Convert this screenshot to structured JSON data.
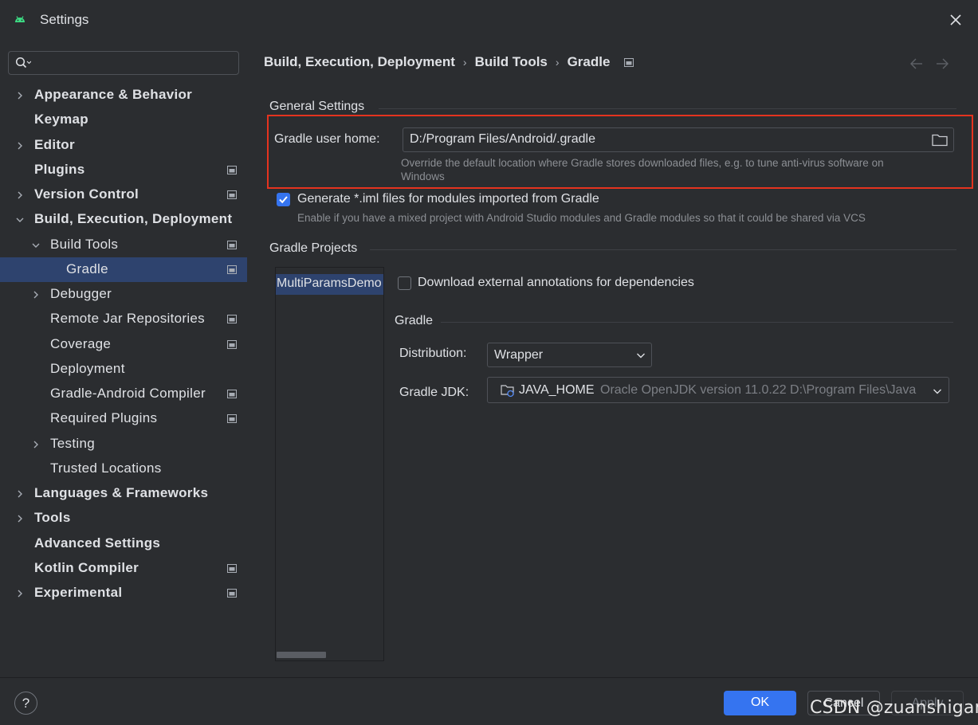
{
  "window": {
    "title": "Settings"
  },
  "sidebar": {
    "search_placeholder": "",
    "items": [
      {
        "label": "Appearance & Behavior",
        "expandable": true,
        "expanded": false,
        "bold": true,
        "project_icon": false
      },
      {
        "label": "Keymap",
        "expandable": false,
        "bold": true,
        "project_icon": false
      },
      {
        "label": "Editor",
        "expandable": true,
        "expanded": false,
        "bold": true,
        "project_icon": false
      },
      {
        "label": "Plugins",
        "expandable": false,
        "bold": true,
        "project_icon": true
      },
      {
        "label": "Version Control",
        "expandable": true,
        "expanded": false,
        "bold": true,
        "project_icon": true
      },
      {
        "label": "Build, Execution, Deployment",
        "expandable": true,
        "expanded": true,
        "bold": true,
        "project_icon": false
      },
      {
        "label": "Build Tools",
        "expandable": true,
        "expanded": true,
        "bold": false,
        "project_icon": true
      },
      {
        "label": "Gradle",
        "expandable": false,
        "bold": false,
        "project_icon": true,
        "selected": true
      },
      {
        "label": "Debugger",
        "expandable": true,
        "expanded": false,
        "bold": false,
        "project_icon": false
      },
      {
        "label": "Remote Jar Repositories",
        "expandable": false,
        "bold": false,
        "project_icon": true
      },
      {
        "label": "Coverage",
        "expandable": false,
        "bold": false,
        "project_icon": true
      },
      {
        "label": "Deployment",
        "expandable": false,
        "bold": false,
        "project_icon": false
      },
      {
        "label": "Gradle-Android Compiler",
        "expandable": false,
        "bold": false,
        "project_icon": true
      },
      {
        "label": "Required Plugins",
        "expandable": false,
        "bold": false,
        "project_icon": true
      },
      {
        "label": "Testing",
        "expandable": true,
        "expanded": false,
        "bold": false,
        "project_icon": false
      },
      {
        "label": "Trusted Locations",
        "expandable": false,
        "bold": false,
        "project_icon": false
      },
      {
        "label": "Languages & Frameworks",
        "expandable": true,
        "expanded": false,
        "bold": true,
        "project_icon": false
      },
      {
        "label": "Tools",
        "expandable": true,
        "expanded": false,
        "bold": true,
        "project_icon": false
      },
      {
        "label": "Advanced Settings",
        "expandable": false,
        "bold": true,
        "project_icon": false
      },
      {
        "label": "Kotlin Compiler",
        "expandable": false,
        "bold": true,
        "project_icon": true
      },
      {
        "label": "Experimental",
        "expandable": true,
        "expanded": false,
        "bold": true,
        "project_icon": true
      }
    ]
  },
  "breadcrumb": [
    "Build, Execution, Deployment",
    "Build Tools",
    "Gradle"
  ],
  "general_settings": {
    "section_title": "General Settings",
    "gradle_user_home_label": "Gradle user home:",
    "gradle_user_home_value": "D:/Program Files/Android/.gradle",
    "gradle_user_home_hint_line1": "Override the default location where Gradle stores downloaded files, e.g. to tune anti-virus software on",
    "gradle_user_home_hint_line2": "Windows",
    "generate_iml_label": "Generate *.iml files for modules imported from Gradle",
    "generate_iml_checked": true,
    "generate_iml_hint": "Enable if you have a mixed project with Android Studio modules and Gradle modules so that it could be shared via VCS"
  },
  "gradle_projects": {
    "section_title": "Gradle Projects",
    "projects": [
      "MultiParamsDemo"
    ],
    "download_annotations_label": "Download external annotations for dependencies",
    "download_annotations_checked": false,
    "gradle_subsection_title": "Gradle",
    "distribution_label": "Distribution:",
    "distribution_value": "Wrapper",
    "gradle_jdk_label": "Gradle JDK:",
    "gradle_jdk_name": "JAVA_HOME",
    "gradle_jdk_detail": "Oracle OpenJDK version 11.0.22 D:\\Program Files\\Java"
  },
  "footer": {
    "help_label": "?",
    "ok_label": "OK",
    "cancel_label": "Cancel",
    "apply_label": "Apply",
    "watermark": "CSDN @zuanshigan"
  },
  "colors": {
    "background": "#2b2d30",
    "selection": "#2e436e",
    "accent": "#3574f0",
    "highlight_border": "#e5331f",
    "android_green": "#3ddc84"
  }
}
